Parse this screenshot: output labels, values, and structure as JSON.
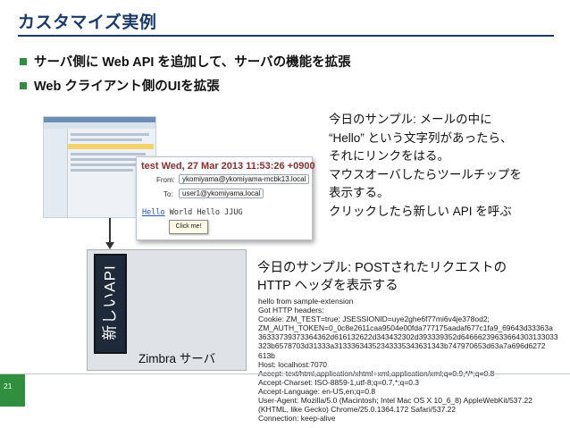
{
  "slide": {
    "title": "カスタマイズ実例",
    "bullets": [
      "サーバ側に Web API を追加して、サーバの機能を拡張",
      "Web クライアント側のUIを拡張"
    ],
    "page_number": "21"
  },
  "mail": {
    "date": "test Wed, 27 Mar 2013 11:53:26 +0900",
    "from_label": "From:",
    "from_value": "ykomiyama@ykomiyama-mcbk13.local",
    "to_label": "To:",
    "to_value": "user1@ykomiyama.local",
    "body_link": "Hello",
    "body_rest": " World  Hello JJUG",
    "tooltip": "Click me!"
  },
  "note1": [
    "今日のサンプル: メールの中に",
    "“Hello” という文字列があったら、",
    "それにリンクをはる。",
    "マウスオーバしたらツールチップを",
    "表示する。",
    "クリックしたら新しい API を呼ぶ"
  ],
  "diagram": {
    "api_label": "新しいAPI",
    "server_label": "Zimbra サーバ"
  },
  "note2": [
    "今日のサンプル: POSTされたリクエストの",
    "HTTP ヘッダを表示する"
  ],
  "log_lines": [
    "hello from sample-extension",
    "Got HTTP headers:",
    "Cookie: ZM_TEST=true; JSESSIONID=uye2ghe6f77mi6v4je378od2;",
    "ZM_AUTH_TOKEN=0_0c8e2611caa9504e00fda777175aadaf677c1fa9_69643d33363a",
    "36333739373364362d616132622d343432302d393339352d64666239633664303133033",
    "323b6578703d31333a31333634352343335343631343b747970653d63a7a696d6272",
    "613b",
    "Host: localhost:7070",
    "Accept: text/html,application/xhtml+xml,application/xml;q=0.9,*/*;q=0.8",
    "Accept-Charset: ISO-8859-1,utf-8;q=0.7,*;q=0.3",
    "Accept-Language: en-US,en;q=0.8",
    "User-Agent: Mozilla/5.0 (Macintosh; Intel Mac OS X 10_6_8) AppleWebKit/537.22",
    "(KHTML, like Gecko) Chrome/25.0.1364.172 Safari/537.22",
    "Connection: keep-alive"
  ]
}
